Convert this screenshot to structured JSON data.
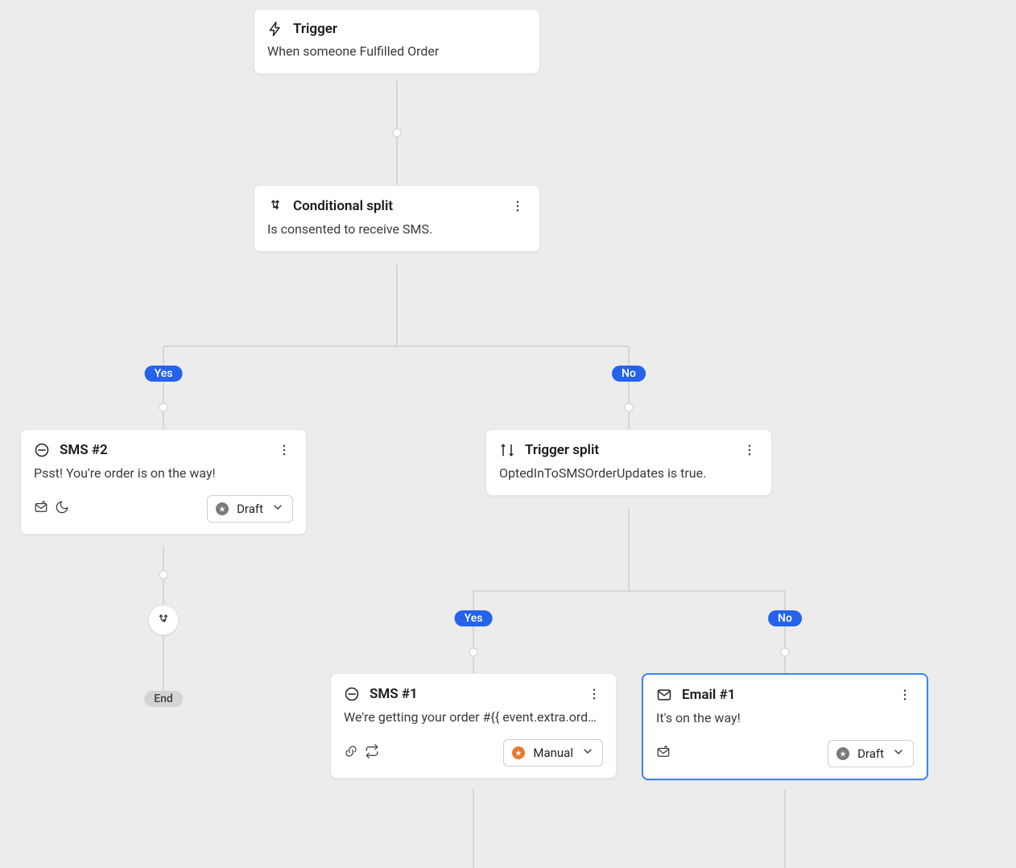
{
  "trigger": {
    "title": "Trigger",
    "description": "When someone Fulfilled Order"
  },
  "conditional_split": {
    "title": "Conditional split",
    "description": "Is consented to receive SMS."
  },
  "branch_yes_label": "Yes",
  "branch_no_label": "No",
  "end_label": "End",
  "sms2": {
    "title": "SMS #2",
    "description": "Psst! You're order is on the way!",
    "status_label": "Draft",
    "status_color": "gray"
  },
  "trigger_split": {
    "title": "Trigger split",
    "description": "OptedInToSMSOrderUpdates is true."
  },
  "ts_branch_yes_label": "Yes",
  "ts_branch_no_label": "No",
  "sms1": {
    "title": "SMS #1",
    "description": "We're getting your order #{{ event.extra.order_number }} ready to ship.",
    "status_label": "Manual",
    "status_color": "orange"
  },
  "email1": {
    "title": "Email #1",
    "description": "It's on the way!",
    "status_label": "Draft",
    "status_color": "gray"
  }
}
